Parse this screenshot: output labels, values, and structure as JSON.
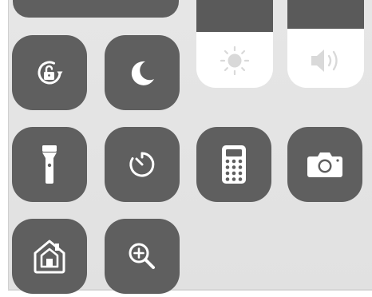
{
  "control_center": {
    "toggles": {
      "rotation_lock": {
        "icon": "rotation-lock-icon"
      },
      "do_not_disturb": {
        "icon": "moon-icon"
      },
      "flashlight": {
        "icon": "flashlight-icon"
      },
      "timer": {
        "icon": "timer-icon"
      },
      "calculator": {
        "icon": "calculator-icon"
      },
      "camera": {
        "icon": "camera-icon"
      },
      "home": {
        "icon": "home-icon"
      },
      "magnifier": {
        "icon": "magnifier-icon"
      }
    },
    "brightness": {
      "icon": "sun-icon",
      "level": 0.5
    },
    "volume": {
      "icon": "speaker-icon",
      "level": 0.53
    }
  },
  "colors": {
    "tile": "#5f5f5f",
    "icon": "#ffffff",
    "panel": "#e4e4e4",
    "slider_fill": "#ffffff",
    "slider_empty": "#5a5a5a",
    "slider_icon": "#d9d9d9"
  }
}
